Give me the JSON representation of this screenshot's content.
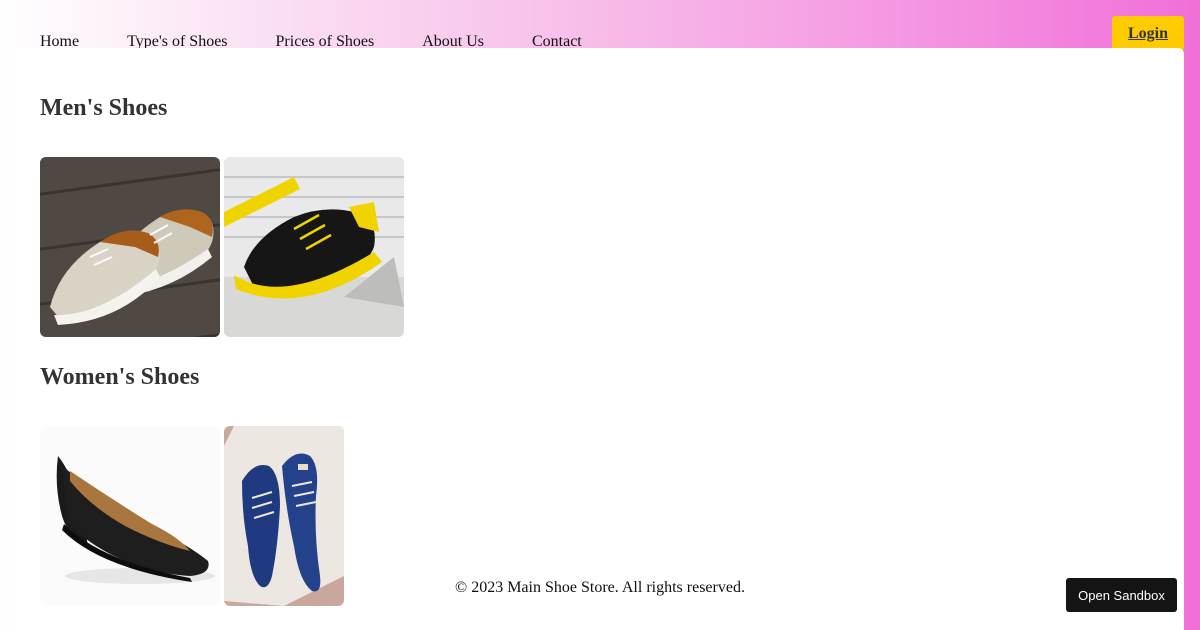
{
  "nav": {
    "items": [
      {
        "label": "Home"
      },
      {
        "label": "Type's of Shoes"
      },
      {
        "label": "Prices of Shoes"
      },
      {
        "label": "About Us"
      },
      {
        "label": "Contact"
      }
    ],
    "login_label": "Login"
  },
  "sections": {
    "men": {
      "title": "Men's Shoes",
      "images": [
        "brown-mesh-sneakers-image",
        "black-yellow-sneakers-image"
      ]
    },
    "women": {
      "title": "Women's Shoes",
      "images": [
        "black-wedge-pump-image",
        "blue-suede-oxford-image"
      ]
    }
  },
  "footer": {
    "copyright": "© 2023 Main Shoe Store. All rights reserved."
  },
  "sandbox": {
    "label": "Open Sandbox"
  },
  "colors": {
    "login_bg": "#ffcc00",
    "gradient_end": "#f06fd8",
    "sandbox_bg": "#141414"
  }
}
